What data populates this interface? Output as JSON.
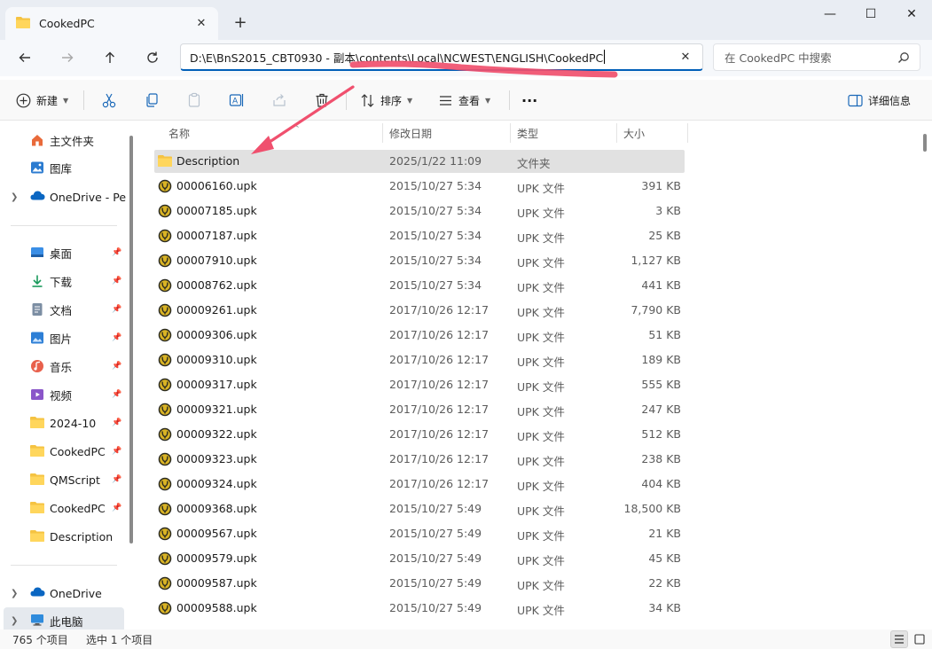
{
  "window": {
    "tab_title": "CookedPC",
    "new_tab_label": "+",
    "close_tab_label": "✕",
    "minimize_label": "—",
    "maximize_label": "☐",
    "close_label": "✕"
  },
  "address": {
    "path": "D:\\E\\BnS2015_CBT0930 - 副本\\contents\\Local\\NCWEST\\ENGLISH\\CookedPC",
    "clear_label": "✕",
    "search_placeholder": "在 CookedPC 中搜索"
  },
  "toolbar": {
    "new_label": "新建",
    "sort_label": "排序",
    "view_label": "查看",
    "more_label": "···",
    "details_label": "详细信息"
  },
  "sidebar": {
    "top_items": [
      {
        "label": "主文件夹",
        "icon": "home-icon"
      },
      {
        "label": "图库",
        "icon": "gallery-icon"
      },
      {
        "label": "OneDrive - Per",
        "icon": "cloud-icon"
      }
    ],
    "quick_access": [
      {
        "label": "桌面",
        "icon": "desktop-icon"
      },
      {
        "label": "下载",
        "icon": "download-icon"
      },
      {
        "label": "文档",
        "icon": "document-icon"
      },
      {
        "label": "图片",
        "icon": "picture-icon"
      },
      {
        "label": "音乐",
        "icon": "music-icon"
      },
      {
        "label": "视频",
        "icon": "video-icon"
      },
      {
        "label": "2024-10",
        "icon": "folder-icon"
      },
      {
        "label": "CookedPC",
        "icon": "folder-icon"
      },
      {
        "label": "QMScript",
        "icon": "folder-icon"
      },
      {
        "label": "CookedPC",
        "icon": "folder-icon"
      },
      {
        "label": "Description",
        "icon": "folder-icon"
      }
    ],
    "bottom_items": [
      {
        "label": "OneDrive",
        "icon": "cloud-icon"
      },
      {
        "label": "此电脑",
        "icon": "computer-icon"
      }
    ]
  },
  "columns": {
    "name": "名称",
    "date": "修改日期",
    "type": "类型",
    "size": "大小"
  },
  "files": [
    {
      "name": "Description",
      "date": "2025/1/22 11:09",
      "type": "文件夹",
      "size": "",
      "kind": "folder"
    },
    {
      "name": "00006160.upk",
      "date": "2015/10/27 5:34",
      "type": "UPK 文件",
      "size": "391 KB",
      "kind": "upk"
    },
    {
      "name": "00007185.upk",
      "date": "2015/10/27 5:34",
      "type": "UPK 文件",
      "size": "3 KB",
      "kind": "upk"
    },
    {
      "name": "00007187.upk",
      "date": "2015/10/27 5:34",
      "type": "UPK 文件",
      "size": "25 KB",
      "kind": "upk"
    },
    {
      "name": "00007910.upk",
      "date": "2015/10/27 5:34",
      "type": "UPK 文件",
      "size": "1,127 KB",
      "kind": "upk"
    },
    {
      "name": "00008762.upk",
      "date": "2015/10/27 5:34",
      "type": "UPK 文件",
      "size": "441 KB",
      "kind": "upk"
    },
    {
      "name": "00009261.upk",
      "date": "2017/10/26 12:17",
      "type": "UPK 文件",
      "size": "7,790 KB",
      "kind": "upk"
    },
    {
      "name": "00009306.upk",
      "date": "2017/10/26 12:17",
      "type": "UPK 文件",
      "size": "51 KB",
      "kind": "upk"
    },
    {
      "name": "00009310.upk",
      "date": "2017/10/26 12:17",
      "type": "UPK 文件",
      "size": "189 KB",
      "kind": "upk"
    },
    {
      "name": "00009317.upk",
      "date": "2017/10/26 12:17",
      "type": "UPK 文件",
      "size": "555 KB",
      "kind": "upk"
    },
    {
      "name": "00009321.upk",
      "date": "2017/10/26 12:17",
      "type": "UPK 文件",
      "size": "247 KB",
      "kind": "upk"
    },
    {
      "name": "00009322.upk",
      "date": "2017/10/26 12:17",
      "type": "UPK 文件",
      "size": "512 KB",
      "kind": "upk"
    },
    {
      "name": "00009323.upk",
      "date": "2017/10/26 12:17",
      "type": "UPK 文件",
      "size": "238 KB",
      "kind": "upk"
    },
    {
      "name": "00009324.upk",
      "date": "2017/10/26 12:17",
      "type": "UPK 文件",
      "size": "404 KB",
      "kind": "upk"
    },
    {
      "name": "00009368.upk",
      "date": "2015/10/27 5:49",
      "type": "UPK 文件",
      "size": "18,500 KB",
      "kind": "upk"
    },
    {
      "name": "00009567.upk",
      "date": "2015/10/27 5:49",
      "type": "UPK 文件",
      "size": "21 KB",
      "kind": "upk"
    },
    {
      "name": "00009579.upk",
      "date": "2015/10/27 5:49",
      "type": "UPK 文件",
      "size": "45 KB",
      "kind": "upk"
    },
    {
      "name": "00009587.upk",
      "date": "2015/10/27 5:49",
      "type": "UPK 文件",
      "size": "22 KB",
      "kind": "upk"
    },
    {
      "name": "00009588.upk",
      "date": "2015/10/27 5:49",
      "type": "UPK 文件",
      "size": "34 KB",
      "kind": "upk"
    }
  ],
  "status": {
    "item_count": "765 个项目",
    "selection": "选中 1 个项目"
  },
  "colors": {
    "accent": "#005fb8",
    "folder": "#f5c342",
    "annotation": "#f0506e"
  }
}
